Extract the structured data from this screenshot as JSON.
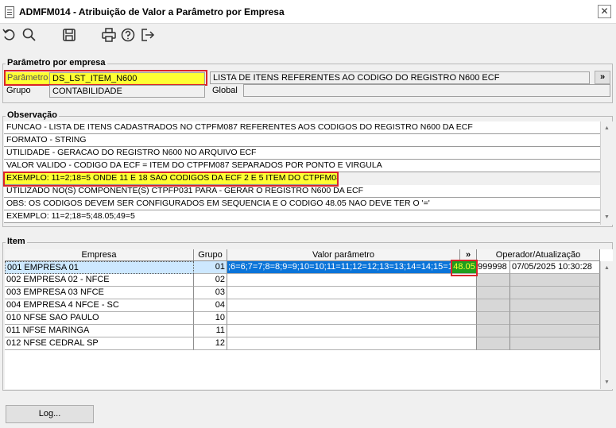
{
  "window": {
    "title": "ADMFM014 - Atribuição de Valor a Parâmetro por Empresa",
    "close_glyph": "✕"
  },
  "toolbar": {
    "icons": [
      "undo-icon",
      "search-icon",
      "save-icon",
      "print-icon",
      "help-icon",
      "exit-icon"
    ]
  },
  "param_group": {
    "legend": "Parâmetro por empresa",
    "param_label": "Parâmetro",
    "param_value": "DS_LST_ITEM_N600",
    "description": "LISTA DE ITENS REFERENTES AO CODIGO DO REGISTRO N600 ECF",
    "lookup_button": "»",
    "group_label": "Grupo",
    "group_value": "CONTABILIDADE",
    "global_label": "Global",
    "global_value": ""
  },
  "obs_group": {
    "legend": "Observação",
    "lines": [
      "FUNCAO - LISTA DE ITENS CADASTRADOS NO CTPFM087 REFERENTES AOS CODIGOS DO REGISTRO N600 DA ECF",
      "FORMATO - STRING",
      "UTILIDADE - GERACAO DO REGISTRO N600 NO ARQUIVO ECF",
      "VALOR VALIDO - CODIGO DA ECF =  ITEM DO CTPFM087 SEPARADOS POR PONTO E VIRGULA",
      "EXEMPLO: 11=2;18=5 ONDE 11 E 18 SAO CODIGOS DA ECF 2 E 5 ITEM DO CTPFM087",
      "UTILIZADO NO(S) COMPONENTE(S) CTPFP031 PARA  - GERAR O REGISTRO N600 DA ECF",
      "OBS: OS CODIGOS DEVEM SER CONFIGURADOS EM SEQUENCIA E O CODIGO 48.05 NAO DEVE TER O '='",
      "EXEMPLO: 11=2;18=5;48.05;49=5"
    ]
  },
  "item_group": {
    "legend": "Item",
    "headers": {
      "empresa": "Empresa",
      "grupo": "Grupo",
      "valor": "Valor parâmetro",
      "expand": "»",
      "operador": "Operador/Atualização"
    },
    "rows": [
      {
        "codigo": "001",
        "empresa": "EMPRESA 01",
        "grupo": "01",
        "valor": ";6=6;7=7;8=8;9=9;10=10;11=11;12=12;13=13;14=14;15=15;",
        "valor_tail": "48.05",
        "operador": "999998",
        "data": "07/05/2025 10:30:28"
      },
      {
        "codigo": "002",
        "empresa": "EMPRESA 02 - NFCE",
        "grupo": "02",
        "valor": "",
        "valor_tail": "",
        "operador": "",
        "data": ""
      },
      {
        "codigo": "003",
        "empresa": "EMPRESA 03 NFCE",
        "grupo": "03",
        "valor": "",
        "valor_tail": "",
        "operador": "",
        "data": ""
      },
      {
        "codigo": "004",
        "empresa": "EMPRESA 4 NFCE - SC",
        "grupo": "04",
        "valor": "",
        "valor_tail": "",
        "operador": "",
        "data": ""
      },
      {
        "codigo": "010",
        "empresa": "NFSE SAO PAULO",
        "grupo": "10",
        "valor": "",
        "valor_tail": "",
        "operador": "",
        "data": ""
      },
      {
        "codigo": "011",
        "empresa": "NFSE MARINGA",
        "grupo": "11",
        "valor": "",
        "valor_tail": "",
        "operador": "",
        "data": ""
      },
      {
        "codigo": "012",
        "empresa": "NFSE CEDRAL SP",
        "grupo": "12",
        "valor": "",
        "valor_tail": "",
        "operador": "",
        "data": ""
      }
    ]
  },
  "footer": {
    "log_button": "Log..."
  },
  "colors": {
    "highlight_yellow": "#ffff33",
    "red_box": "#d9242a",
    "selected_row": "#cde8ff",
    "selected_cell": "#0a74d9",
    "tail_cell": "#1f9e1f"
  }
}
